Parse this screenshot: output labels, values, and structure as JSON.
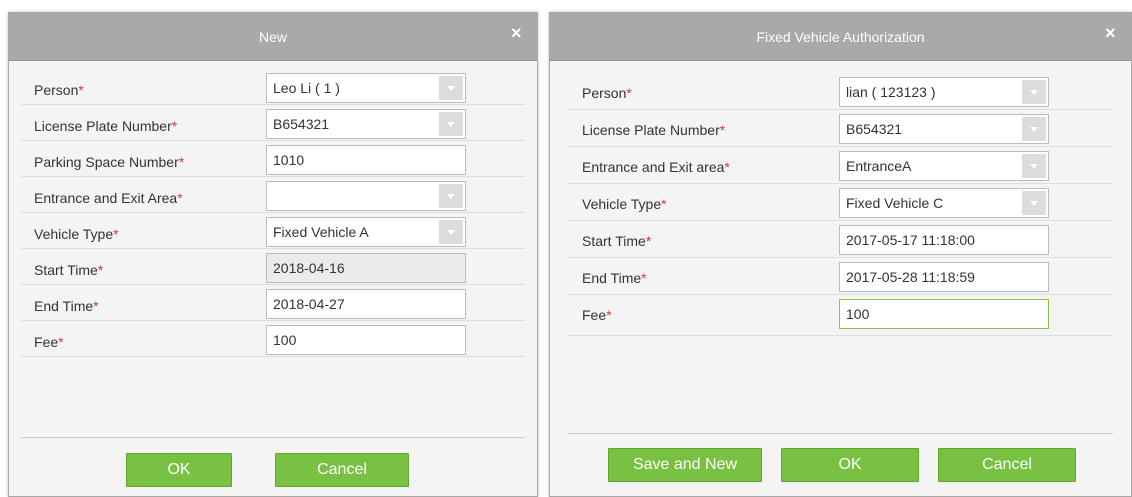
{
  "dialog_new": {
    "title": "New",
    "close_glyph": "×",
    "fields": [
      {
        "label": "Person",
        "value": "Leo Li ( 1 )"
      },
      {
        "label": "License Plate Number",
        "value": "B654321"
      },
      {
        "label": "Parking Space Number",
        "value": "1010"
      },
      {
        "label": "Entrance and Exit Area",
        "value": ""
      },
      {
        "label": "Vehicle Type",
        "value": "Fixed Vehicle A"
      },
      {
        "label": "Start Time",
        "value": "2018-04-16"
      },
      {
        "label": "End Time",
        "value": "2018-04-27"
      },
      {
        "label": "Fee",
        "value": "100"
      }
    ],
    "required_mark": "*",
    "ok_label": "OK",
    "cancel_label": "Cancel"
  },
  "dialog_fixed": {
    "title": "Fixed Vehicle Authorization",
    "close_glyph": "×",
    "fields": [
      {
        "label": "Person",
        "value": "lian ( 123123 )"
      },
      {
        "label": "License Plate Number",
        "value": "B654321"
      },
      {
        "label": "Entrance and Exit area",
        "value": "EntranceA"
      },
      {
        "label": "Vehicle Type",
        "value": "Fixed Vehicle C"
      },
      {
        "label": "Start Time",
        "value": "2017-05-17 11:18:00"
      },
      {
        "label": "End Time",
        "value": "2017-05-28 11:18:59"
      },
      {
        "label": "Fee",
        "value": "100"
      }
    ],
    "required_mark": "*",
    "save_new_label": "Save and New",
    "ok_label": "OK",
    "cancel_label": "Cancel"
  },
  "colors": {
    "title_bar": "#a9a9a9",
    "button_green": "#78c142",
    "required_red": "#e53333",
    "focus_border": "#8cc63f"
  }
}
